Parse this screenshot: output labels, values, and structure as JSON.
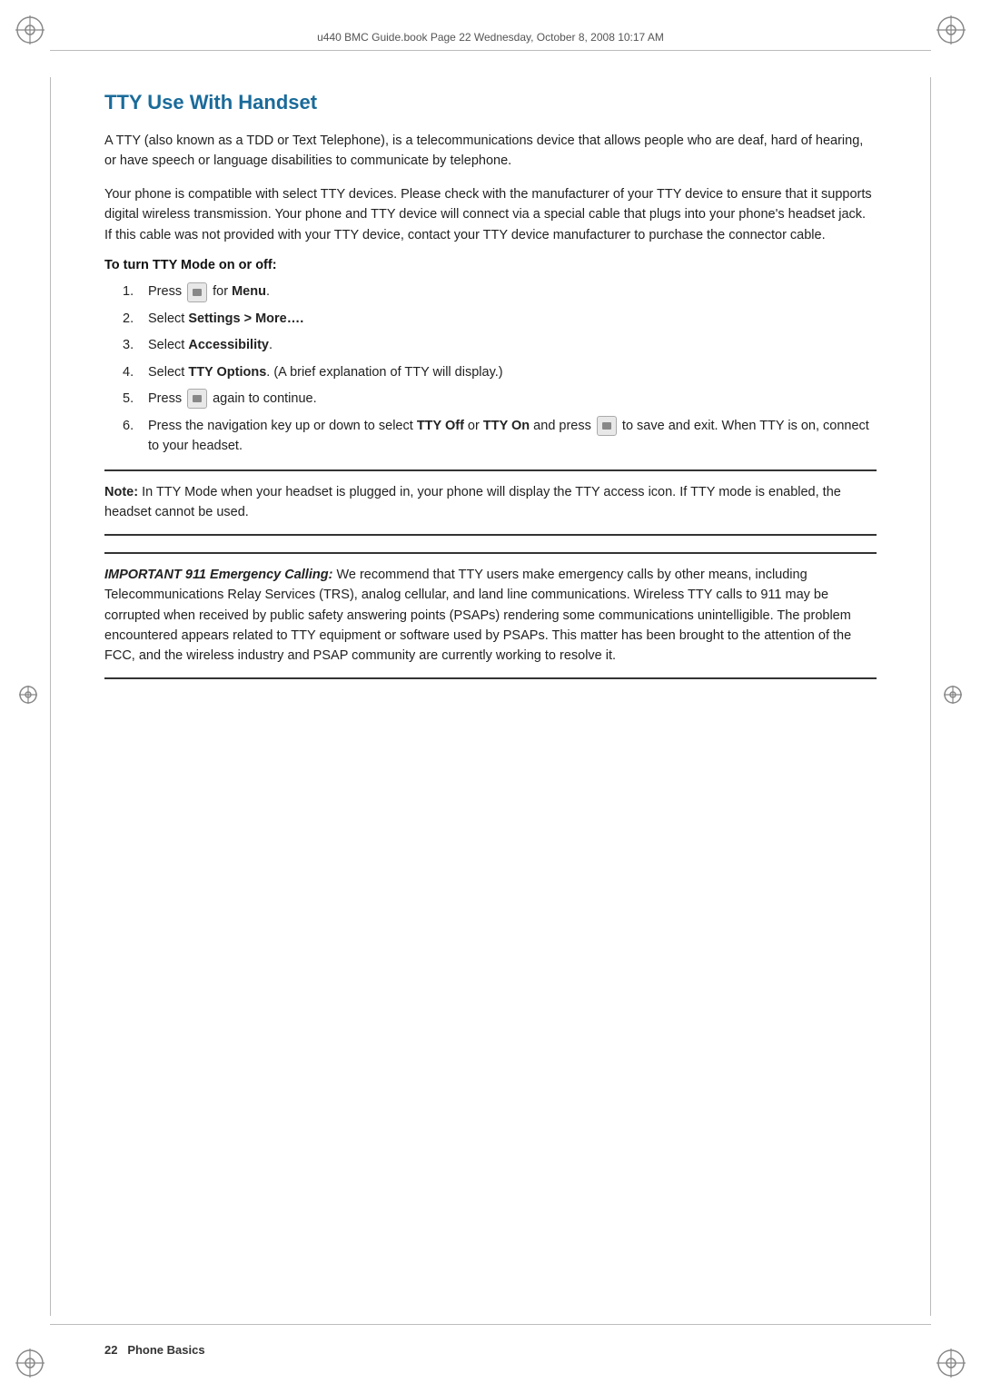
{
  "header": {
    "text": "u440 BMC Guide.book  Page 22  Wednesday, October 8, 2008  10:17 AM"
  },
  "title": "TTY Use With Handset",
  "paragraphs": {
    "p1": "A TTY (also known as a TDD or Text Telephone), is a telecommunications device that allows people who are deaf, hard of hearing, or have speech or language disabilities to communicate by telephone.",
    "p2": "Your phone is compatible with select TTY devices. Please check with the manufacturer of your TTY device to ensure that it supports digital wireless transmission. Your phone and TTY device will connect via a special cable that plugs into your phone's headset jack. If this cable was not provided with your TTY device, contact your TTY device manufacturer to purchase the connector cable."
  },
  "section_heading": "To turn TTY Mode on or off:",
  "steps": [
    {
      "num": "1.",
      "text_before": "Press ",
      "button": true,
      "text_bold": "Menu",
      "text_after": "."
    },
    {
      "num": "2.",
      "text_before": "Select ",
      "text_bold": "Settings > More….",
      "text_after": ""
    },
    {
      "num": "3.",
      "text_before": "Select ",
      "text_bold": "Accessibility",
      "text_after": "."
    },
    {
      "num": "4.",
      "text_before": "Select ",
      "text_bold": "TTY Options",
      "text_after": ". (A brief explanation of TTY will display.)"
    },
    {
      "num": "5.",
      "text_before": "Press ",
      "button": true,
      "text_after": " again to continue."
    },
    {
      "num": "6.",
      "text_before": "Press the navigation key up or down to select ",
      "text_bold_1": "TTY Off",
      "text_mid": " or ",
      "text_bold_2": "TTY On",
      "text_after": " and press ",
      "button": true,
      "text_final": " to save and exit. When TTY is on, connect to your headset."
    }
  ],
  "note": {
    "label": "Note:",
    "text": " In TTY Mode when your headset is plugged in, your phone will display the TTY access icon. If TTY mode is enabled, the headset cannot be used."
  },
  "important": {
    "label": "IMPORTANT 911 Emergency Calling:",
    "text": " We recommend that TTY users make emergency calls by other means, including Telecommunications Relay Services (TRS), analog cellular, and land line communications. Wireless TTY calls to 911 may be corrupted when received by public safety answering points (PSAPs) rendering some communications unintelligible. The problem encountered appears related to TTY equipment or software used by PSAPs. This matter has been brought to the attention of the FCC, and the wireless industry and PSAP community are currently working to resolve it."
  },
  "footer": {
    "page_num": "22",
    "section": "Phone Basics"
  }
}
